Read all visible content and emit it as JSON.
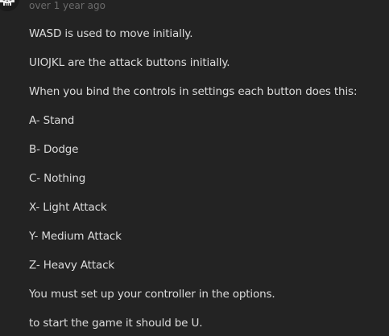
{
  "comment": {
    "avatar_icon": "skull-avatar-icon",
    "timestamp": "over 1 year ago",
    "lines": [
      "WASD is used to move initially.",
      "UIOJKL are the attack buttons initially.",
      "When you bind the controls in settings each button does this:",
      "A- Stand",
      "B- Dodge",
      "C- Nothing",
      "X- Light Attack",
      "Y- Medium Attack",
      "Z- Heavy Attack",
      "You must set up your controller in the options.",
      "to start the game it should be U."
    ]
  },
  "colors": {
    "background": "#232323",
    "text": "#dcdcdc",
    "muted": "#6b6b6b"
  }
}
